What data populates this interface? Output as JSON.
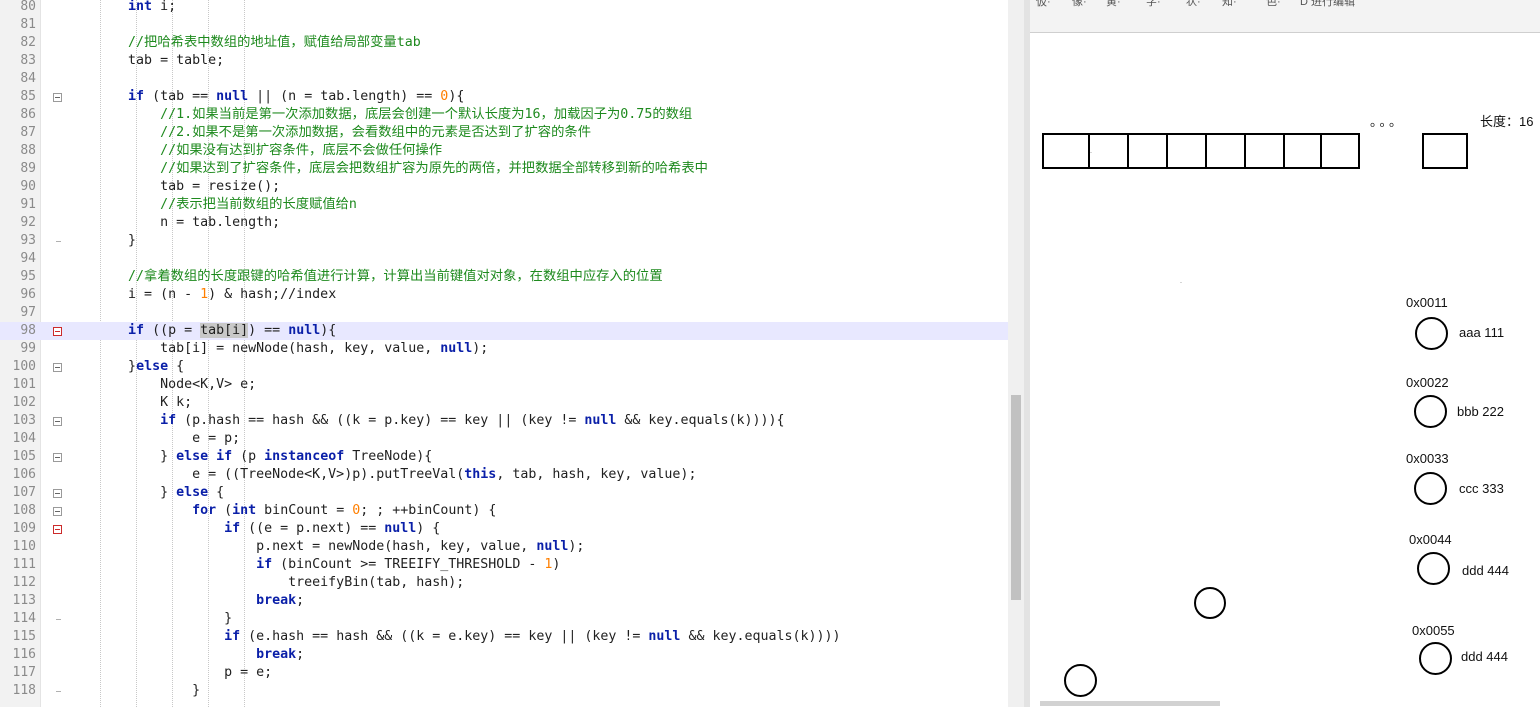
{
  "editor": {
    "lines": [
      {
        "n": "80",
        "t": "code",
        "s": [
          [
            "        ",
            ""
          ],
          [
            "int",
            "kw"
          ],
          [
            " i;",
            ""
          ]
        ]
      },
      {
        "n": "81",
        "t": "code",
        "s": []
      },
      {
        "n": "82",
        "t": "cm",
        "s": [
          [
            "        //把哈希表中数组的地址值，赋值给局部变量tab",
            ""
          ]
        ]
      },
      {
        "n": "83",
        "t": "code",
        "s": [
          [
            "        tab = table;",
            ""
          ]
        ]
      },
      {
        "n": "84",
        "t": "code",
        "s": []
      },
      {
        "n": "85",
        "t": "code",
        "fold": "open",
        "s": [
          [
            "        ",
            ""
          ],
          [
            "if",
            "kw"
          ],
          [
            " (tab == ",
            ""
          ],
          [
            "null",
            "kw"
          ],
          [
            " || (n = tab.length) == ",
            ""
          ],
          [
            "0",
            "num"
          ],
          [
            "){",
            ""
          ]
        ]
      },
      {
        "n": "86",
        "t": "cm",
        "s": [
          [
            "            //1.如果当前是第一次添加数据，底层会创建一个默认长度为16，加载因子为0.75的数组",
            ""
          ]
        ]
      },
      {
        "n": "87",
        "t": "cm",
        "s": [
          [
            "            //2.如果不是第一次添加数据，会看数组中的元素是否达到了扩容的条件",
            ""
          ]
        ]
      },
      {
        "n": "88",
        "t": "cm",
        "s": [
          [
            "            //如果没有达到扩容条件，底层不会做任何操作",
            ""
          ]
        ]
      },
      {
        "n": "89",
        "t": "cm",
        "s": [
          [
            "            //如果达到了扩容条件，底层会把数组扩容为原先的两倍，并把数据全部转移到新的哈希表中",
            ""
          ]
        ]
      },
      {
        "n": "90",
        "t": "code",
        "s": [
          [
            "            tab = resize();",
            ""
          ]
        ]
      },
      {
        "n": "91",
        "t": "cm",
        "s": [
          [
            "            //表示把当前数组的长度赋值给n",
            ""
          ]
        ]
      },
      {
        "n": "92",
        "t": "code",
        "s": [
          [
            "            n = tab.length;",
            ""
          ]
        ]
      },
      {
        "n": "93",
        "t": "code",
        "foldend": true,
        "s": [
          [
            "        }",
            ""
          ]
        ]
      },
      {
        "n": "94",
        "t": "code",
        "s": []
      },
      {
        "n": "95",
        "t": "cm",
        "s": [
          [
            "        //拿着数组的长度跟键的哈希值进行计算，计算出当前键值对对象，在数组中应存入的位置",
            ""
          ]
        ]
      },
      {
        "n": "96",
        "t": "code",
        "s": [
          [
            "        i = (n - ",
            ""
          ],
          [
            "1",
            "num"
          ],
          [
            ") & hash;//index",
            ""
          ]
        ]
      },
      {
        "n": "97",
        "t": "code",
        "s": []
      },
      {
        "n": "98",
        "t": "code",
        "fold": "red",
        "current": true,
        "s": [
          [
            "        ",
            ""
          ],
          [
            "if",
            "kw"
          ],
          [
            " ((p = ",
            ""
          ],
          [
            "tab[i]",
            "sel"
          ],
          [
            ") == ",
            ""
          ],
          [
            "null",
            "kw"
          ],
          [
            "){",
            ""
          ]
        ]
      },
      {
        "n": "99",
        "t": "code",
        "s": [
          [
            "            tab[i] = newNode(hash, key, value, ",
            ""
          ],
          [
            "null",
            "kw"
          ],
          [
            ");",
            ""
          ]
        ]
      },
      {
        "n": "100",
        "t": "code",
        "fold": "open",
        "s": [
          [
            "        }",
            ""
          ],
          [
            "else",
            "kw"
          ],
          [
            " {",
            ""
          ]
        ]
      },
      {
        "n": "101",
        "t": "code",
        "s": [
          [
            "            Node<K,V> e;",
            ""
          ]
        ]
      },
      {
        "n": "102",
        "t": "code",
        "s": [
          [
            "            K k;",
            ""
          ]
        ]
      },
      {
        "n": "103",
        "t": "code",
        "fold": "open",
        "s": [
          [
            "            ",
            ""
          ],
          [
            "if",
            "kw"
          ],
          [
            " (p.hash == hash && ((k = p.key) == key || (key != ",
            ""
          ],
          [
            "null",
            "kw"
          ],
          [
            " && key.equals(k)))){",
            ""
          ]
        ]
      },
      {
        "n": "104",
        "t": "code",
        "s": [
          [
            "                e = p;",
            ""
          ]
        ]
      },
      {
        "n": "105",
        "t": "code",
        "fold": "open",
        "s": [
          [
            "            } ",
            ""
          ],
          [
            "else if",
            "kw"
          ],
          [
            " (p ",
            ""
          ],
          [
            "instanceof",
            "kw"
          ],
          [
            " TreeNode){",
            ""
          ]
        ]
      },
      {
        "n": "106",
        "t": "code",
        "s": [
          [
            "                e = ((TreeNode<K,V>)p).putTreeVal(",
            ""
          ],
          [
            "this",
            "kw"
          ],
          [
            ", tab, hash, key, value);",
            ""
          ]
        ]
      },
      {
        "n": "107",
        "t": "code",
        "fold": "open",
        "s": [
          [
            "            } ",
            ""
          ],
          [
            "else",
            "kw"
          ],
          [
            " {",
            ""
          ]
        ]
      },
      {
        "n": "108",
        "t": "code",
        "fold": "open",
        "s": [
          [
            "                ",
            ""
          ],
          [
            "for",
            "kw"
          ],
          [
            " (",
            ""
          ],
          [
            "int",
            "kw"
          ],
          [
            " binCount = ",
            ""
          ],
          [
            "0",
            "num"
          ],
          [
            "; ; ++binCount) {",
            ""
          ]
        ]
      },
      {
        "n": "109",
        "t": "code",
        "fold": "red",
        "s": [
          [
            "                    ",
            ""
          ],
          [
            "if",
            "kw"
          ],
          [
            " ((e = p.next) == ",
            ""
          ],
          [
            "null",
            "kw"
          ],
          [
            ") {",
            ""
          ]
        ]
      },
      {
        "n": "110",
        "t": "code",
        "s": [
          [
            "                        p.next = newNode(hash, key, value, ",
            ""
          ],
          [
            "null",
            "kw"
          ],
          [
            ");",
            ""
          ]
        ]
      },
      {
        "n": "111",
        "t": "code",
        "s": [
          [
            "                        ",
            ""
          ],
          [
            "if",
            "kw"
          ],
          [
            " (binCount >= TREEIFY_THRESHOLD - ",
            ""
          ],
          [
            "1",
            "num"
          ],
          [
            ")",
            ""
          ]
        ]
      },
      {
        "n": "112",
        "t": "code",
        "s": [
          [
            "                            treeifyBin(tab, hash);",
            ""
          ]
        ]
      },
      {
        "n": "113",
        "t": "code",
        "s": [
          [
            "                        ",
            ""
          ],
          [
            "break",
            "kw"
          ],
          [
            ";",
            ""
          ]
        ]
      },
      {
        "n": "114",
        "t": "code",
        "foldend": true,
        "s": [
          [
            "                    }",
            ""
          ]
        ]
      },
      {
        "n": "115",
        "t": "code",
        "s": [
          [
            "                    ",
            ""
          ],
          [
            "if",
            "kw"
          ],
          [
            " (e.hash == hash && ((k = e.key) == key || (key != ",
            ""
          ],
          [
            "null",
            "kw"
          ],
          [
            " && key.equals(k))))",
            ""
          ]
        ]
      },
      {
        "n": "116",
        "t": "code",
        "s": [
          [
            "                        ",
            ""
          ],
          [
            "break",
            "kw"
          ],
          [
            ";",
            ""
          ]
        ]
      },
      {
        "n": "117",
        "t": "code",
        "s": [
          [
            "                    p = e;",
            ""
          ]
        ]
      },
      {
        "n": "118",
        "t": "code",
        "foldend": true,
        "s": [
          [
            "                }",
            ""
          ]
        ]
      }
    ]
  },
  "toolbar": {
    "items": [
      "仮·",
      "像·",
      "黄·",
      "字·",
      "状·",
      "知·",
      "色·",
      "D 进行编辑"
    ]
  },
  "drawing": {
    "array_cells": 8,
    "ellipsis": "。。。",
    "length_label": "长度：16",
    "nodes": [
      {
        "address": "0x0011",
        "entry": "aaa  111"
      },
      {
        "address": "0x0022",
        "entry": "bbb 222"
      },
      {
        "address": "0x0033",
        "entry": "ccc 333"
      },
      {
        "address": "0x0044",
        "entry": "ddd 444"
      },
      {
        "address": "0x0055",
        "entry": "ddd 444"
      }
    ]
  }
}
